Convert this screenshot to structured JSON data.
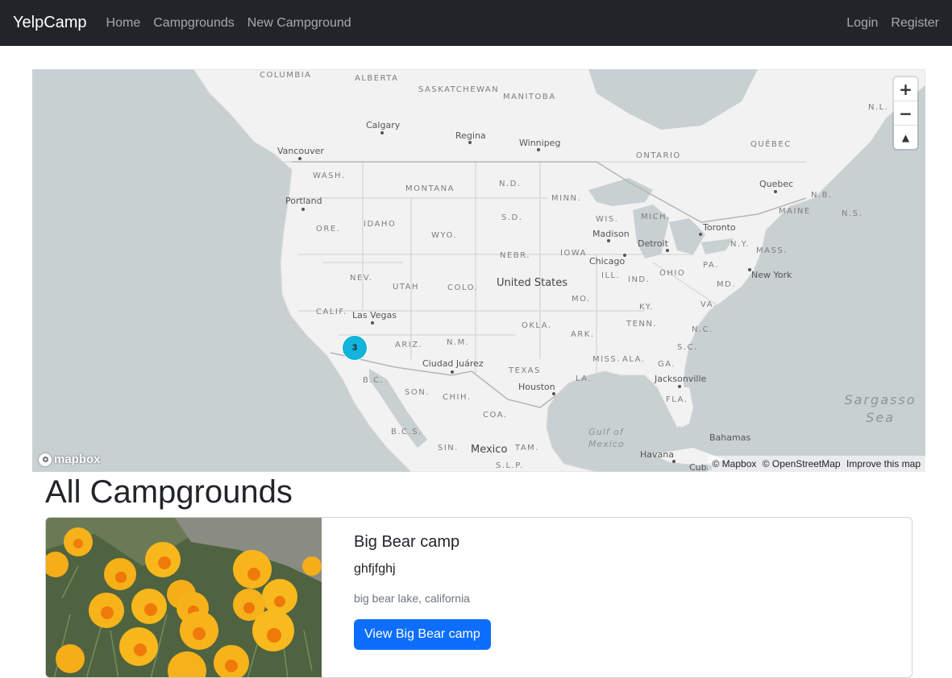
{
  "navbar": {
    "brand": "YelpCamp",
    "links": [
      "Home",
      "Campgrounds",
      "New Campground"
    ],
    "right_links": [
      "Login",
      "Register"
    ]
  },
  "map": {
    "provinces": [
      "COLUMBIA",
      "ALBERTA",
      "SASKATCHEWAN",
      "MANITOBA",
      "ONTARIO",
      "QUÉBEC",
      "N.L.",
      "N.B.",
      "N.S.",
      "WASH.",
      "MONTANA",
      "N.D.",
      "MINN.",
      "ORE.",
      "IDAHO",
      "WYO.",
      "S.D.",
      "WIS.",
      "MICH.",
      "MAINE",
      "N.Y.",
      "MASS.",
      "NEBR.",
      "IOWA",
      "PA.",
      "NEV.",
      "UTAH",
      "COLO.",
      "ILL.",
      "IND.",
      "OHIO",
      "MD.",
      "CALIF.",
      "KY.",
      "VA.",
      "MO.",
      "OKLA.",
      "ARK.",
      "TENN.",
      "N.C.",
      "S.C.",
      "ARIZ.",
      "N.M.",
      "MISS.",
      "ALA.",
      "GA.",
      "TEXAS",
      "LA.",
      "FLA.",
      "SON.",
      "CHIH.",
      "COA.",
      "B.C.S.",
      "SIN.",
      "TAM.",
      "S.L.P.",
      "B.C."
    ],
    "cities": [
      "Calgary",
      "Regina",
      "Winnipeg",
      "Vancouver",
      "Portland",
      "Quebec",
      "Toronto",
      "Madison",
      "Detroit",
      "Chicago",
      "New York",
      "Las Vegas",
      "Ciudad Juárez",
      "Houston",
      "Jacksonville",
      "Bahamas",
      "Havana",
      "Cuba"
    ],
    "country": "United States",
    "mexico": "Mexico",
    "gulf": "Gulf of Mexico",
    "sargasso": "Sargasso Sea",
    "cluster_count": "3",
    "zoom_in": "+",
    "zoom_out": "−",
    "compass": "▲",
    "logo_text": "mapbox",
    "attribution": [
      "© Mapbox",
      "© OpenStreetMap",
      "Improve this map"
    ]
  },
  "page": {
    "title": "All Campgrounds"
  },
  "campgrounds": [
    {
      "title": "Big Bear camp",
      "description": "ghfjfghj",
      "location": "big bear lake, california",
      "button_label": "View Big Bear camp"
    }
  ],
  "colors": {
    "navbar_bg": "#212529",
    "primary": "#0d6efd",
    "cluster": "#11b4da",
    "water": "#c8d0d2",
    "land": "#f2f2f2"
  }
}
